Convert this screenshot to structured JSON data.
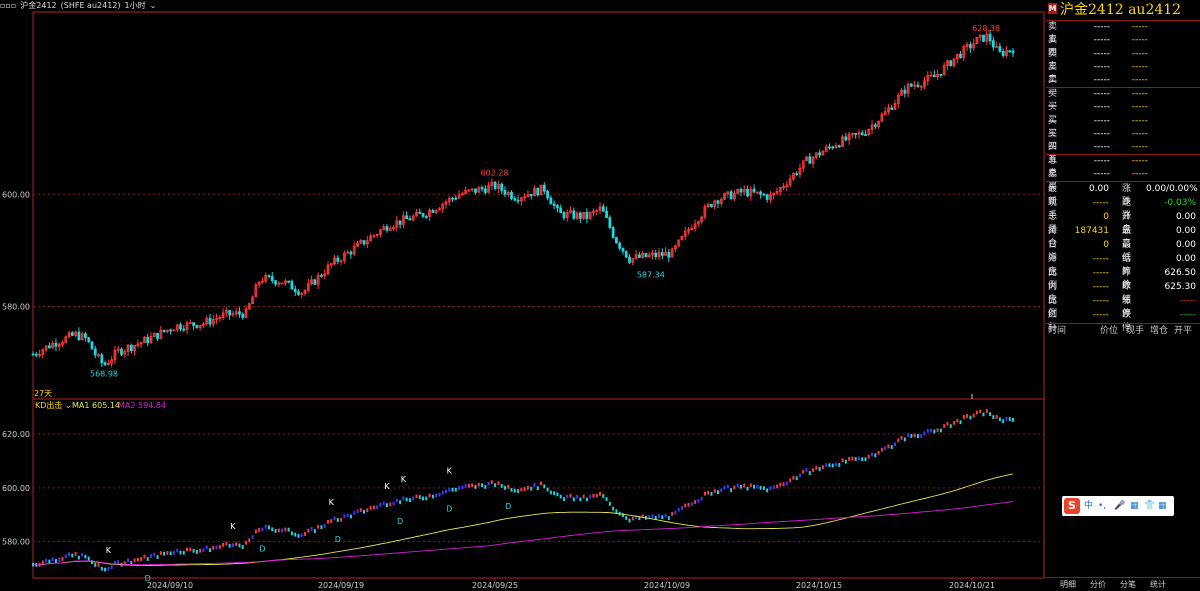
{
  "topbar": {
    "mode": "▫▫▫",
    "symbol": "沪金2412",
    "exchange": "(SHFE au2412)",
    "period": "1小时",
    "dropdown": "⌄"
  },
  "main_chart_labels": {
    "high_label": "628.38",
    "peak2_label": "602.28",
    "low2_label": "587.34",
    "low_label": "568.98",
    "days_label": "27天"
  },
  "indicator_legend": {
    "name": "KD出击",
    "arrow": "⌄",
    "ma1": "MA1 605.14",
    "ma2": "MA2 594.84"
  },
  "panel": {
    "marker": "M",
    "title": "沪金2412  au2412",
    "asks": [
      {
        "label": "卖五",
        "v1": "-----",
        "v2": "-----"
      },
      {
        "label": "卖四",
        "v1": "-----",
        "v2": "-----"
      },
      {
        "label": "卖三",
        "v1": "-----",
        "v2": "-----"
      },
      {
        "label": "卖二",
        "v1": "-----",
        "v2": "-----"
      },
      {
        "label": "卖一",
        "v1": "-----",
        "v2": "-----"
      }
    ],
    "bids": [
      {
        "label": "买一",
        "v1": "-----",
        "v2": "-----"
      },
      {
        "label": "买二",
        "v1": "-----",
        "v2": "-----"
      },
      {
        "label": "买三",
        "v1": "-----",
        "v2": "-----"
      },
      {
        "label": "买四",
        "v1": "-----",
        "v2": "-----"
      },
      {
        "label": "买五",
        "v1": "-----",
        "v2": "-----"
      }
    ],
    "totals": [
      {
        "label": "总卖",
        "v1": "-----",
        "v2": "-----"
      },
      {
        "label": "总买",
        "v1": "-----",
        "v2": "-----"
      }
    ],
    "stats": [
      {
        "al": "最新",
        "av": "0.00",
        "ac": "white",
        "bl": "涨跌",
        "bv": "0.00/0.00%",
        "bc": "white"
      },
      {
        "al": "现手",
        "av": "-----",
        "ac": "yellow",
        "bl": "速涨",
        "bv": "-0.03%",
        "bc": "green"
      },
      {
        "al": "总量",
        "av": "0",
        "ac": "yellow",
        "bl": "开盘",
        "bv": "0.00",
        "bc": "white"
      },
      {
        "al": "持仓",
        "av": "187431",
        "ac": "yellow",
        "bl": "最高",
        "bv": "0.00",
        "bc": "white"
      },
      {
        "al": "日增",
        "av": "0",
        "ac": "yellow",
        "bl": "最低",
        "bv": "0.00",
        "bc": "white"
      },
      {
        "al": "外盘",
        "av": "-----",
        "ac": "yellow",
        "bl": "结算价 ⌄",
        "bv": "0.00",
        "bc": "white"
      },
      {
        "al": "比例",
        "av": "-----",
        "ac": "yellow",
        "bl": "昨收",
        "bv": "626.50",
        "bc": "white"
      },
      {
        "al": "内盘",
        "av": "-----",
        "ac": "yellow",
        "bl": "昨结",
        "bv": "625.30",
        "bc": "white"
      },
      {
        "al": "比例",
        "av": "-----",
        "ac": "yellow",
        "bl": "涨停",
        "bv": "-----",
        "bc": "red"
      },
      {
        "al": "红杆",
        "av": "-----",
        "ac": "yellow",
        "bl": "跌停",
        "bv": "-----",
        "bc": "green"
      }
    ],
    "tick_headers": [
      "时间",
      "价位",
      "现手",
      "增仓",
      "开平"
    ],
    "bottom_tabs": [
      "明细",
      "分价",
      "分笔",
      "统计"
    ]
  },
  "ime": {
    "logo": "S",
    "items": [
      "中",
      "•,",
      "🎤",
      "▦",
      "👕",
      "▦"
    ]
  },
  "colors": {
    "up": "#ff3a3a",
    "down": "#1cd8e0",
    "ma1": "#e6e64a",
    "ma2": "#d21fd2",
    "grid": "#8b1a1a",
    "frame": "#b22222"
  },
  "chart_data": {
    "type": "candlestick",
    "price_panel": {
      "ylim": [
        563.5,
        632.5
      ],
      "yticks": [
        "580.00",
        "600.00"
      ],
      "annotations": {
        "high": 628.38,
        "peak": 602.28,
        "trough": 587.34,
        "low": 568.98
      }
    },
    "indicator_panel": {
      "ylim": [
        566.5,
        633.0
      ],
      "yticks": [
        "580.00",
        "600.00",
        "620.00"
      ],
      "signals": [
        {
          "label": "K",
          "at": 0.107
        },
        {
          "label": "D",
          "at": 0.163
        },
        {
          "label": "K",
          "at": 0.281
        },
        {
          "label": "D",
          "at": 0.325
        },
        {
          "label": "K",
          "at": 0.421
        },
        {
          "label": "D",
          "at": 0.428
        },
        {
          "label": "K",
          "at": 0.499
        },
        {
          "label": "D",
          "at": 0.517
        },
        {
          "label": "K",
          "at": 0.523
        },
        {
          "label": "K",
          "at": 0.587
        },
        {
          "label": "D",
          "at": 0.585
        },
        {
          "label": "D",
          "at": 0.67
        }
      ]
    },
    "x_labels": [
      "2024/09/10",
      "2024/09/19",
      "2024/09/25",
      "2024/10/09",
      "2024/10/15",
      "2024/10/21"
    ],
    "ma1_end": 605.14,
    "ma2_end": 594.84,
    "anchors": [
      [
        0,
        571.5
      ],
      [
        0.03,
        573.5
      ],
      [
        0.06,
        575
      ],
      [
        0.075,
        574.2
      ],
      [
        0.09,
        571
      ],
      [
        0.1,
        569.5
      ],
      [
        0.12,
        572
      ],
      [
        0.16,
        574
      ],
      [
        0.2,
        576.5
      ],
      [
        0.24,
        577
      ],
      [
        0.27,
        578.5
      ],
      [
        0.3,
        578.8
      ],
      [
        0.32,
        585
      ],
      [
        0.35,
        584.5
      ],
      [
        0.38,
        582.5
      ],
      [
        0.42,
        587.5
      ],
      [
        0.46,
        591
      ],
      [
        0.5,
        594.5
      ],
      [
        0.55,
        596.5
      ],
      [
        0.6,
        600
      ],
      [
        0.65,
        601.5
      ],
      [
        0.68,
        599.5
      ],
      [
        0.72,
        601
      ],
      [
        0.74,
        596.5
      ],
      [
        0.78,
        596
      ],
      [
        0.8,
        597.5
      ],
      [
        0.82,
        592
      ],
      [
        0.84,
        588.5
      ],
      [
        0.87,
        589
      ],
      [
        0.9,
        589.5
      ],
      [
        0.93,
        595
      ],
      [
        0.96,
        599
      ],
      [
        1.0,
        600.5
      ],
      [
        1.04,
        599.5
      ],
      [
        1.09,
        606
      ],
      [
        1.13,
        609
      ],
      [
        1.17,
        611
      ],
      [
        1.2,
        614.5
      ],
      [
        1.23,
        619
      ],
      [
        1.27,
        621
      ],
      [
        1.3,
        624.5
      ],
      [
        1.33,
        627.5
      ],
      [
        1.345,
        628.2
      ],
      [
        1.36,
        625
      ],
      [
        1.38,
        626
      ]
    ]
  }
}
